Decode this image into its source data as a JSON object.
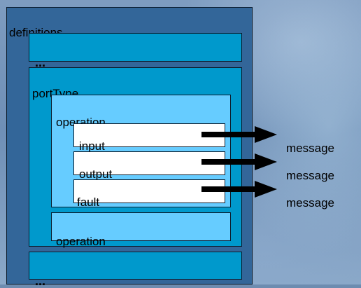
{
  "diagram": {
    "definitions_label": "definitions",
    "portType_label": "portType",
    "operation1_label": "operation",
    "operation2_label": "operation",
    "input_label": "input",
    "output_label": "output",
    "fault_label": "fault",
    "ellipsis_top": "...",
    "ellipsis_bottom": "...",
    "message_labels": [
      "message",
      "message",
      "message"
    ]
  },
  "colors": {
    "definitions_fill": "#336699",
    "band_fill": "#0099cc",
    "porttype_fill": "#0099cc",
    "operation_fill": "#66ccff",
    "message_box_fill": "#ffffff",
    "arrow_color": "#000000"
  }
}
